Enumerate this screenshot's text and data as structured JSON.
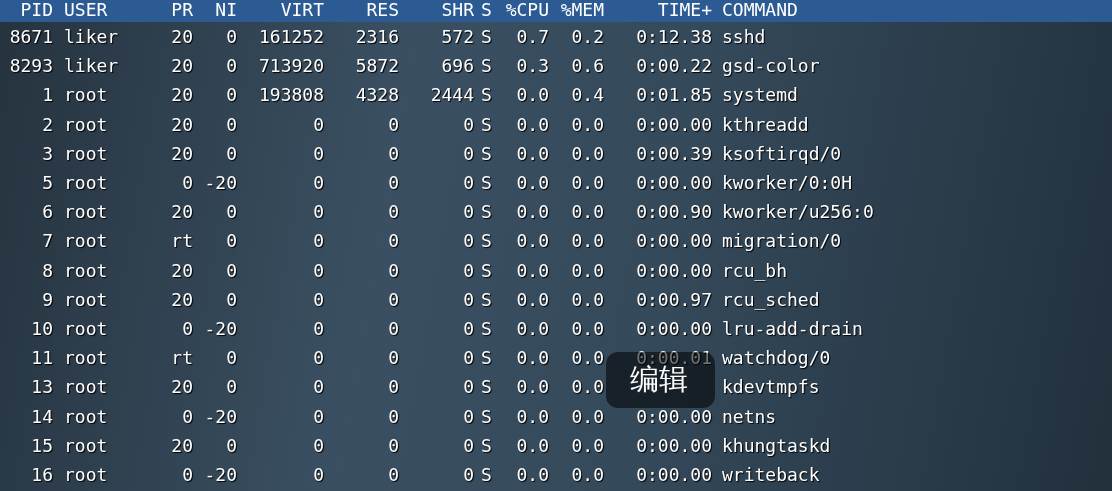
{
  "header": [
    "PID",
    "USER",
    "PR",
    "NI",
    "VIRT",
    "RES",
    "SHR",
    "S",
    "%CPU",
    "%MEM",
    "TIME+",
    "COMMAND"
  ],
  "rows": [
    [
      "8671",
      "liker",
      "20",
      "0",
      "161252",
      "2316",
      "572",
      "S",
      "0.7",
      "0.2",
      "0:12.38",
      "sshd"
    ],
    [
      "8293",
      "liker",
      "20",
      "0",
      "713920",
      "5872",
      "696",
      "S",
      "0.3",
      "0.6",
      "0:00.22",
      "gsd-color"
    ],
    [
      "1",
      "root",
      "20",
      "0",
      "193808",
      "4328",
      "2444",
      "S",
      "0.0",
      "0.4",
      "0:01.85",
      "systemd"
    ],
    [
      "2",
      "root",
      "20",
      "0",
      "0",
      "0",
      "0",
      "S",
      "0.0",
      "0.0",
      "0:00.00",
      "kthreadd"
    ],
    [
      "3",
      "root",
      "20",
      "0",
      "0",
      "0",
      "0",
      "S",
      "0.0",
      "0.0",
      "0:00.39",
      "ksoftirqd/0"
    ],
    [
      "5",
      "root",
      "0",
      "-20",
      "0",
      "0",
      "0",
      "S",
      "0.0",
      "0.0",
      "0:00.00",
      "kworker/0:0H"
    ],
    [
      "6",
      "root",
      "20",
      "0",
      "0",
      "0",
      "0",
      "S",
      "0.0",
      "0.0",
      "0:00.90",
      "kworker/u256:0"
    ],
    [
      "7",
      "root",
      "rt",
      "0",
      "0",
      "0",
      "0",
      "S",
      "0.0",
      "0.0",
      "0:00.00",
      "migration/0"
    ],
    [
      "8",
      "root",
      "20",
      "0",
      "0",
      "0",
      "0",
      "S",
      "0.0",
      "0.0",
      "0:00.00",
      "rcu_bh"
    ],
    [
      "9",
      "root",
      "20",
      "0",
      "0",
      "0",
      "0",
      "S",
      "0.0",
      "0.0",
      "0:00.97",
      "rcu_sched"
    ],
    [
      "10",
      "root",
      "0",
      "-20",
      "0",
      "0",
      "0",
      "S",
      "0.0",
      "0.0",
      "0:00.00",
      "lru-add-drain"
    ],
    [
      "11",
      "root",
      "rt",
      "0",
      "0",
      "0",
      "0",
      "S",
      "0.0",
      "0.0",
      "0:00.01",
      "watchdog/0"
    ],
    [
      "13",
      "root",
      "20",
      "0",
      "0",
      "0",
      "0",
      "S",
      "0.0",
      "0.0",
      null,
      "kdevtmpfs"
    ],
    [
      "14",
      "root",
      "0",
      "-20",
      "0",
      "0",
      "0",
      "S",
      "0.0",
      "0.0",
      "0:00.00",
      "netns"
    ],
    [
      "15",
      "root",
      "20",
      "0",
      "0",
      "0",
      "0",
      "S",
      "0.0",
      "0.0",
      "0:00.00",
      "khungtaskd"
    ],
    [
      "16",
      "root",
      "0",
      "-20",
      "0",
      "0",
      "0",
      "S",
      "0.0",
      "0.0",
      "0:00.00",
      "writeback"
    ]
  ],
  "tooltip": {
    "label": "编辑"
  }
}
